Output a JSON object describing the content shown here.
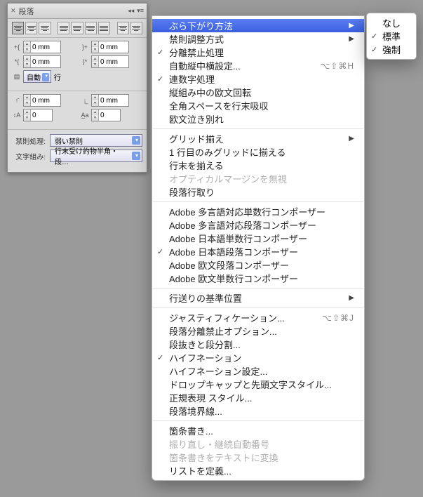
{
  "panel": {
    "title": "段落",
    "indent": {
      "left": "0 mm",
      "right": "0 mm",
      "first_line": "0 mm",
      "last_line": "0 mm"
    },
    "autoleading": {
      "value": "自動",
      "unit": "行"
    },
    "spacing": {
      "before": "0 mm",
      "after": "0 mm"
    },
    "dropcap": {
      "lines": "0",
      "chars": "0"
    },
    "kinsoku": {
      "label": "禁則処理:",
      "value": "弱い禁則"
    },
    "mojikumi": {
      "label": "文字組み:",
      "value": "行末受け約物半角・段…"
    }
  },
  "menu": {
    "items": [
      {
        "label": "ぶら下がり方法",
        "selected": true,
        "hasSub": true
      },
      {
        "label": "禁則調整方式",
        "hasSub": true
      },
      {
        "label": "分離禁止処理",
        "checked": true
      },
      {
        "label": "自動縦中横設定...",
        "shortcut": "⌥⇧⌘H"
      },
      {
        "label": "連数字処理",
        "checked": true
      },
      {
        "label": "縦組み中の欧文回転"
      },
      {
        "label": "全角スペースを行末吸収"
      },
      {
        "label": "欧文泣き別れ"
      },
      {
        "sep": true
      },
      {
        "label": "グリッド揃え",
        "hasSub": true
      },
      {
        "label": "1 行目のみグリッドに揃える"
      },
      {
        "label": "行末を揃える"
      },
      {
        "label": "オプティカルマージンを無視",
        "disabled": true
      },
      {
        "label": "段落行取り"
      },
      {
        "sep": true
      },
      {
        "label": "Adobe 多言語対応単数行コンポーザー"
      },
      {
        "label": "Adobe 多言語対応段落コンポーザー"
      },
      {
        "label": "Adobe 日本語単数行コンポーザー"
      },
      {
        "label": "Adobe 日本語段落コンポーザー",
        "checked": true
      },
      {
        "label": "Adobe 欧文段落コンポーザー"
      },
      {
        "label": "Adobe 欧文単数行コンポーザー"
      },
      {
        "sep": true
      },
      {
        "label": "行送りの基準位置",
        "hasSub": true
      },
      {
        "sep": true
      },
      {
        "label": "ジャスティフィケーション...",
        "shortcut": "⌥⇧⌘J"
      },
      {
        "label": "段落分離禁止オプション..."
      },
      {
        "label": "段抜きと段分割..."
      },
      {
        "label": "ハイフネーション",
        "checked": true
      },
      {
        "label": "ハイフネーション設定..."
      },
      {
        "label": "ドロップキャップと先頭文字スタイル..."
      },
      {
        "label": "正規表現 スタイル..."
      },
      {
        "label": "段落境界線..."
      },
      {
        "sep": true
      },
      {
        "label": "箇条書き..."
      },
      {
        "label": "振り直し・継続自動番号",
        "disabled": true
      },
      {
        "label": "箇条書きをテキストに変換",
        "disabled": true
      },
      {
        "label": "リストを定義..."
      }
    ]
  },
  "submenu": {
    "items": [
      {
        "label": "なし"
      },
      {
        "label": "標準",
        "checked": true
      },
      {
        "label": "強制",
        "checked": true
      }
    ]
  }
}
